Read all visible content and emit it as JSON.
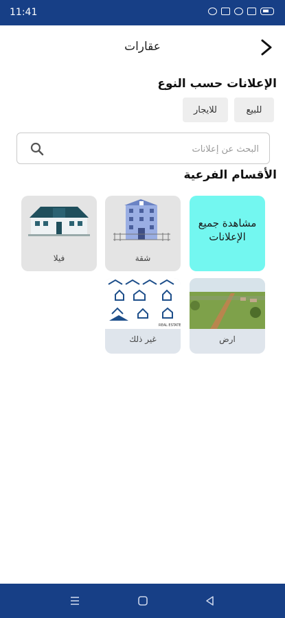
{
  "status_bar": {
    "time": "11:41"
  },
  "app_bar": {
    "title": "عقارات"
  },
  "type_section": {
    "title": "الإعلانات حسب النوع",
    "chips": [
      "للبيع",
      "للايجار"
    ]
  },
  "search": {
    "placeholder": "البحث عن إعلانات"
  },
  "subcategories": {
    "title": "الأقسام الفرعية",
    "items": [
      {
        "label": "مشاهدة جميع الإعلانات",
        "color": "#73f7f0"
      },
      {
        "label": "شقة"
      },
      {
        "label": "فيلا"
      },
      {
        "label": "ارض"
      },
      {
        "label": "غير ذلك"
      }
    ]
  },
  "colors": {
    "primary": "#173f86",
    "accent": "#73f7f0",
    "card": "#e4e4e4"
  },
  "icons": [
    "back-chevron-icon",
    "search-icon",
    "menu-icon",
    "home-icon",
    "back-triangle-icon"
  ]
}
